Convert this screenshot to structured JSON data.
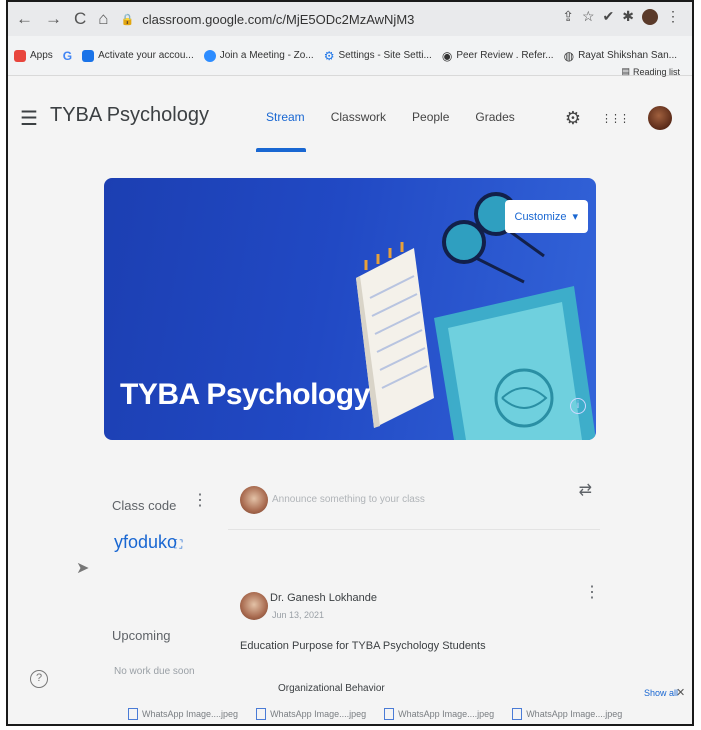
{
  "browser": {
    "nav_back": "←",
    "nav_forward": "→",
    "nav_reload": "C",
    "nav_home": "⌂",
    "url": "classroom.google.com/c/MjE5ODc2MzAwNjM3",
    "bookmarks": [
      {
        "label": "Apps",
        "color": "#e8453c"
      },
      {
        "label": "G",
        "color": "#4285f4"
      },
      {
        "label": "Activate your accou...",
        "color": "#1a73e8"
      },
      {
        "label": "Join a Meeting - Zo...",
        "color": "#2d8cff"
      },
      {
        "label": "Settings - Site Setti...",
        "color": "#1a73e8"
      },
      {
        "label": "Peer Review . Refer...",
        "color": "#333333"
      },
      {
        "label": "Rayat Shikshan San...",
        "color": "#444444"
      }
    ],
    "reading_list": "Reading list"
  },
  "header": {
    "menu_icon": "☰",
    "class_title": "TYBA Psychology",
    "tabs": [
      "Stream",
      "Classwork",
      "People",
      "Grades"
    ],
    "active_tab": "Stream",
    "settings_icon": "⚙",
    "apps_icon": "⋮⋮⋮"
  },
  "banner": {
    "title": "TYBA Psychology",
    "customize_label": "Customize",
    "customize_caret": "▾",
    "info_icon": "i"
  },
  "left": {
    "class_code_label": "Class code",
    "kebab": "⋮",
    "class_code": "yfoduko",
    "fullscreen_icon": "⛶",
    "upcoming_label": "Upcoming",
    "no_work_text": "No work due soon"
  },
  "stream": {
    "announce_placeholder": "Announce something to your class",
    "repost_icon": "⇄",
    "post": {
      "author": "Dr. Ganesh Lokhande",
      "date": "Jun 13, 2021",
      "kebab": "⋮",
      "title": "Education Purpose for TYBA Psychology Students",
      "subtitle": "Organizational Behavior"
    }
  },
  "downloads": {
    "items": [
      "WhatsApp Image....jpeg",
      "WhatsApp Image....jpeg",
      "WhatsApp Image....jpeg",
      "WhatsApp Image....jpeg"
    ],
    "show_all": "Show all",
    "close": "✕"
  },
  "help_icon": "?",
  "colors": {
    "accent": "#1967d2",
    "banner": "#2149c4"
  }
}
